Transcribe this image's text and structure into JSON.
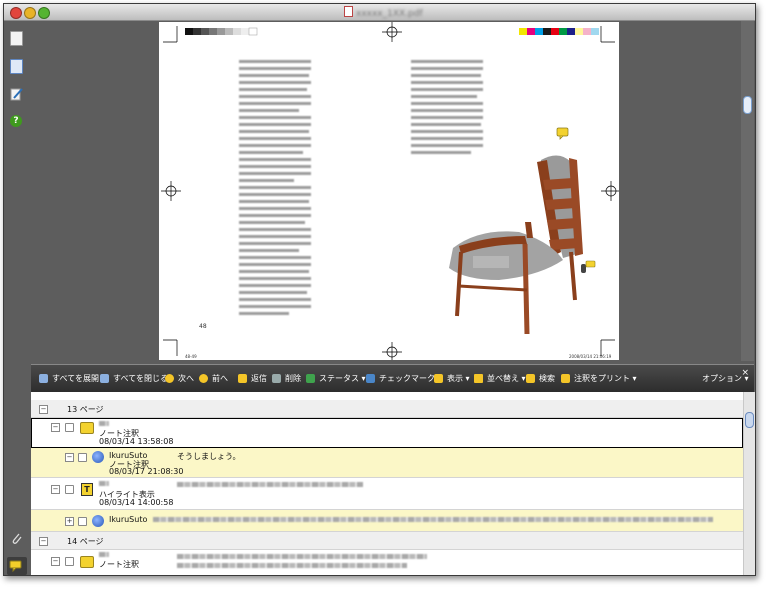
{
  "window": {
    "title": "xxxxx_1XX.pdf"
  },
  "toolbar": {
    "expand_all": "すべてを展開",
    "collapse_all": "すべてを閉じる",
    "next": "次へ",
    "previous": "前へ",
    "reply": "返信",
    "delete": "削除",
    "status": "ステータス",
    "checkmark": "チェックマーク",
    "show": "表示",
    "sort": "並べ替え",
    "search": "検索",
    "print_comments": "注釈をプリント",
    "options": "オプション",
    "close": "×"
  },
  "comments": {
    "page13": "13 ページ",
    "page14": "14 ページ",
    "items": [
      {
        "type": "ノート注釈",
        "date": "08/03/14 13:58:08"
      },
      {
        "author": "IkuruSuto",
        "type": "ノート注釈",
        "date": "08/03/17 21:08:30",
        "text": "そうしましょう。"
      },
      {
        "type": "ハイライト表示",
        "date": "08/03/14 14:00:58"
      },
      {
        "author": "IkuruSuto"
      },
      {
        "type": "ノート注釈"
      }
    ]
  },
  "page": {
    "left_folio": "48",
    "bottom_left_marker": "48-49",
    "bottom_right_marker": "2008/03/14 21:06:19"
  },
  "colors": {
    "highlight_row": "#fbf7c7",
    "toolbar": "#2d2d2d",
    "page_bg": "#5d5d5d",
    "chair_wood": "#9a4a26",
    "chair_fur": "#9a9a9a"
  },
  "icons": [
    "pages-icon",
    "attachment-page-icon",
    "signature-icon",
    "help-icon",
    "paperclip-icon",
    "comments-icon"
  ]
}
